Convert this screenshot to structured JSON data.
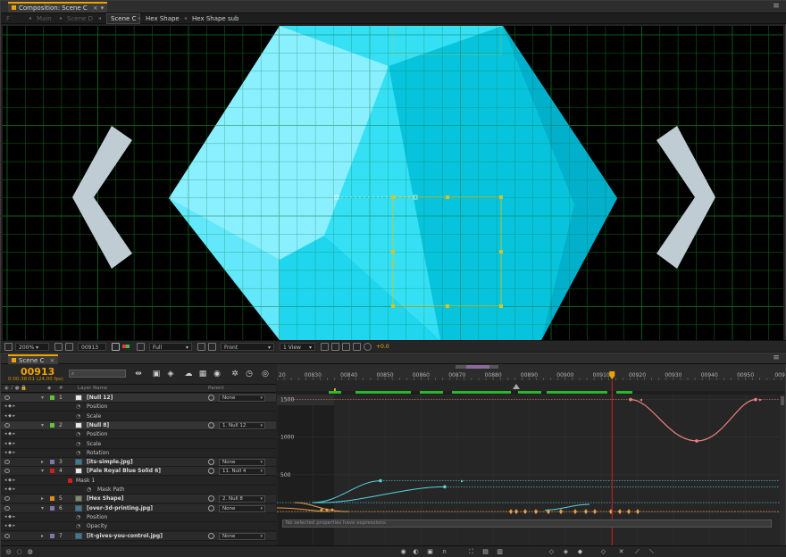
{
  "comp_panel": {
    "tab_title": "Composition: Scene C",
    "breadcrumbs": [
      {
        "label": "F",
        "state": "dim"
      },
      {
        "label": "Main",
        "state": "dim"
      },
      {
        "label": "Scene D",
        "state": "dim"
      },
      {
        "label": "Scene C",
        "state": "active"
      },
      {
        "label": "Hex Shape",
        "state": "normal"
      },
      {
        "label": "Hex Shape sub",
        "state": "normal"
      }
    ],
    "bottom_bar": {
      "zoom": "200%",
      "timecode": "00913",
      "resolution": "Full",
      "view": "Front",
      "views": "1 View",
      "exposure": "+0.0"
    }
  },
  "viewer": {
    "colors": {
      "background": "#000000",
      "grid": "#0b5a0b",
      "hex_light": "#8aefff",
      "hex_mid": "#35e0f5",
      "hex_dark": "#07c4dc",
      "hex_deep": "#02b0cc",
      "arrow": "#c0ccd4",
      "selection": "#d6c425"
    }
  },
  "timeline": {
    "tab_title": "Scene C",
    "current_time": "00913",
    "current_time_sub": "0:00:38:01 (24.00 fps)",
    "columns": {
      "layer_name": "Layer Name",
      "parent": "Parent",
      "hash": "#"
    },
    "rows": [
      {
        "kind": "layer",
        "num": "1",
        "name": "[Null 12]",
        "color": "#63c23a",
        "icon": "solid",
        "parent": "None",
        "selected": true
      },
      {
        "kind": "prop",
        "name": "Position"
      },
      {
        "kind": "prop",
        "name": "Scale"
      },
      {
        "kind": "layer",
        "num": "2",
        "name": "[Null 8]",
        "color": "#63c23a",
        "icon": "solid",
        "parent": "1. Null 12",
        "selected": true
      },
      {
        "kind": "prop",
        "name": "Position"
      },
      {
        "kind": "prop",
        "name": "Scale"
      },
      {
        "kind": "prop",
        "name": "Rotation"
      },
      {
        "kind": "layer",
        "num": "3",
        "name": "[its-simple.jpg]",
        "color": "#7a7aa8",
        "icon": "img",
        "parent": "None",
        "selected": false
      },
      {
        "kind": "layer",
        "num": "4",
        "name": "[Pale Royal Blue Solid 6]",
        "color": "#d21d1d",
        "icon": "solid",
        "parent": "11. Null 4",
        "selected": false
      },
      {
        "kind": "prop",
        "name": "Mask 1",
        "mask": true
      },
      {
        "kind": "prop",
        "name": "Mask Path",
        "deep": true
      },
      {
        "kind": "layer",
        "num": "5",
        "name": "[Hex Shape]",
        "color": "#e38b1b",
        "icon": "comp",
        "parent": "2. Null 8",
        "selected": false
      },
      {
        "kind": "layer",
        "num": "6",
        "name": "[over-3d-printing.jpg]",
        "color": "#7a7aa8",
        "icon": "img",
        "parent": "None",
        "selected": false
      },
      {
        "kind": "prop",
        "name": "Position"
      },
      {
        "kind": "prop",
        "name": "Opacity"
      },
      {
        "kind": "layer",
        "num": "7",
        "name": "[it-gives-you-control.jpg]",
        "color": "#7a7aa8",
        "icon": "img",
        "parent": "None",
        "selected": false
      }
    ],
    "ruler": {
      "ticks": [
        "20",
        "00830",
        "00840",
        "00850",
        "00860",
        "00870",
        "00880",
        "00890",
        "00900",
        "00910",
        "00920",
        "00930",
        "00940",
        "00950",
        "0096"
      ],
      "range": [
        820,
        961
      ],
      "playhead": 913
    },
    "graph": {
      "y_labels": [
        "1500",
        "1000",
        "500"
      ],
      "y_range": [
        0,
        1600
      ],
      "expression_text": "No selected properties have expressions.",
      "colors": {
        "red_curve": "#f08080",
        "cyan_curve": "#56d4e0",
        "orange_curve": "#e8a050",
        "playhead": "#d42020"
      }
    }
  }
}
